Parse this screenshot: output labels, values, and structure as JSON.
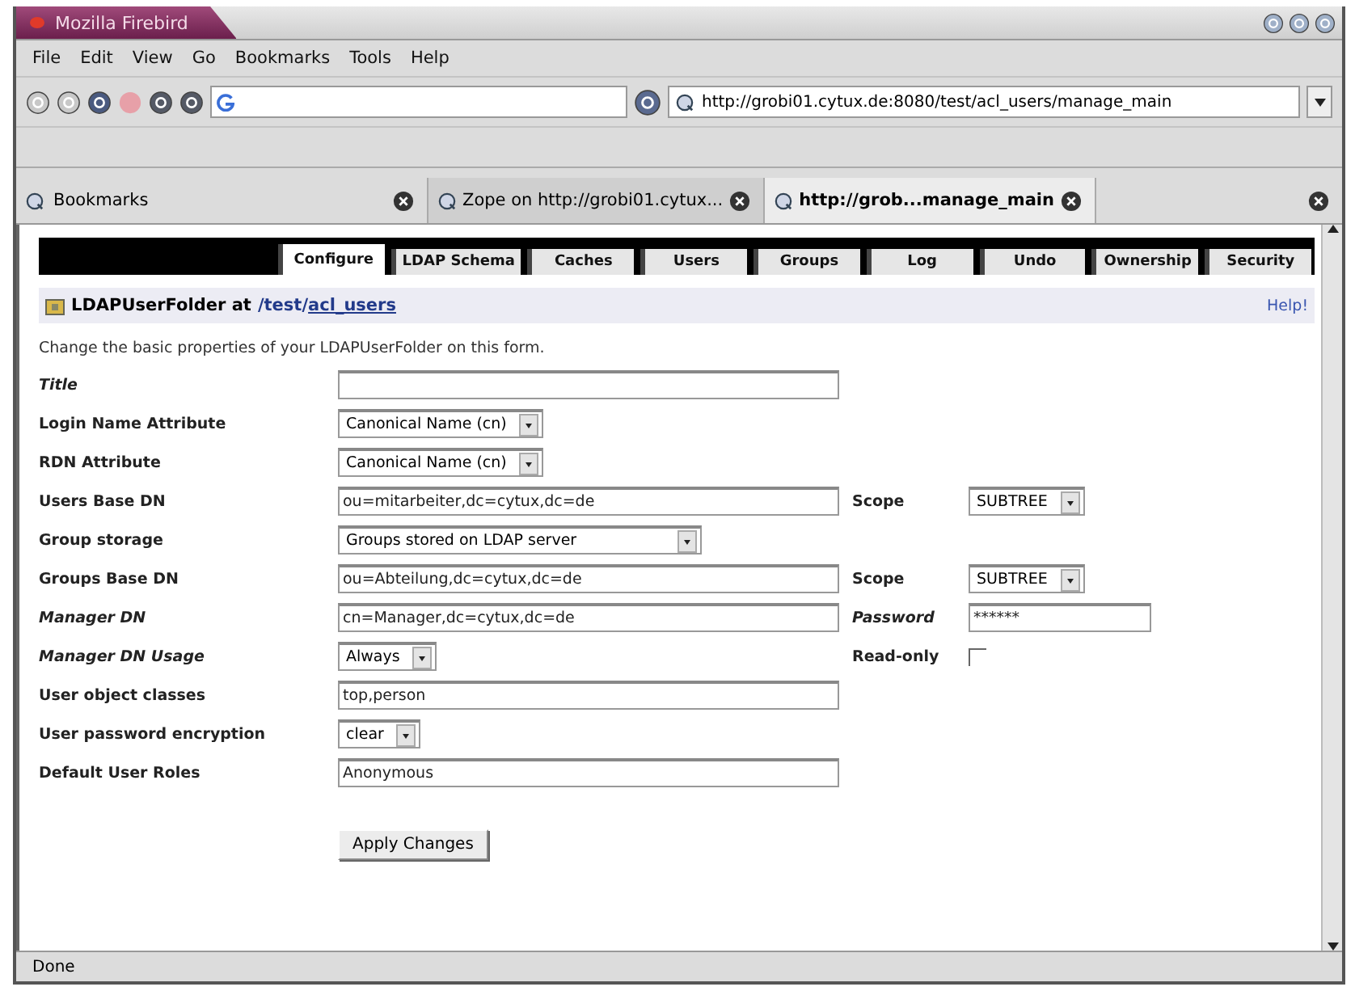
{
  "window": {
    "title": "Mozilla Firebird"
  },
  "menu": [
    "File",
    "Edit",
    "View",
    "Go",
    "Bookmarks",
    "Tools",
    "Help"
  ],
  "navigation": {
    "address": "http://grobi01.cytux.de:8080/test/acl_users/manage_main"
  },
  "sidebar_header": {
    "title": "Bookmarks"
  },
  "browser_tabs": [
    {
      "label": "Zope on http://grobi01.cytux...",
      "selected": false
    },
    {
      "label": "http://grob...manage_main",
      "selected": true
    }
  ],
  "zope_tabs": [
    {
      "label": "Configure",
      "selected": true
    },
    {
      "label": "LDAP Schema",
      "selected": false
    },
    {
      "label": "Caches",
      "selected": false
    },
    {
      "label": "Users",
      "selected": false
    },
    {
      "label": "Groups",
      "selected": false
    },
    {
      "label": "Log",
      "selected": false
    },
    {
      "label": "Undo",
      "selected": false
    },
    {
      "label": "Ownership",
      "selected": false
    },
    {
      "label": "Security",
      "selected": false
    }
  ],
  "heading": {
    "prefix": "LDAPUserFolder at",
    "path_root": "/test/",
    "path_link": "acl_users",
    "help": "Help!"
  },
  "intro": "Change the basic properties of your LDAPUserFolder on this form.",
  "form_rows": [
    {
      "label": "Title",
      "italic": true,
      "kind": "text",
      "value": ""
    },
    {
      "label": "Login Name Attribute",
      "italic": false,
      "kind": "select",
      "value": "Canonical Name (cn)"
    },
    {
      "label": "RDN Attribute",
      "italic": false,
      "kind": "select",
      "value": "Canonical Name (cn)"
    },
    {
      "label": "Users Base DN",
      "italic": false,
      "kind": "text",
      "value": "ou=mitarbeiter,dc=cytux,dc=de",
      "extra": {
        "label": "Scope",
        "italic": false,
        "kind": "select",
        "value": "SUBTREE"
      }
    },
    {
      "label": "Group storage",
      "italic": false,
      "kind": "select",
      "value": "Groups stored on LDAP server"
    },
    {
      "label": "Groups Base DN",
      "italic": false,
      "kind": "text",
      "value": "ou=Abteilung,dc=cytux,dc=de",
      "extra": {
        "label": "Scope",
        "italic": false,
        "kind": "select",
        "value": "SUBTREE"
      }
    },
    {
      "label": "Manager DN",
      "italic": true,
      "kind": "text",
      "value": "cn=Manager,dc=cytux,dc=de",
      "extra": {
        "label": "Password",
        "italic": true,
        "kind": "password",
        "value": "******"
      }
    },
    {
      "label": "Manager DN Usage",
      "italic": true,
      "kind": "select",
      "value": "Always",
      "extra": {
        "label": "Read-only",
        "italic": false,
        "kind": "checkbox",
        "checked": false
      }
    },
    {
      "label": "User object classes",
      "italic": false,
      "kind": "text",
      "value": "top,person"
    },
    {
      "label": "User password encryption",
      "italic": false,
      "kind": "select",
      "value": "clear"
    },
    {
      "label": "Default User Roles",
      "italic": false,
      "kind": "text",
      "value": "Anonymous"
    }
  ],
  "submit": "Apply Changes",
  "status_bar": "Done"
}
